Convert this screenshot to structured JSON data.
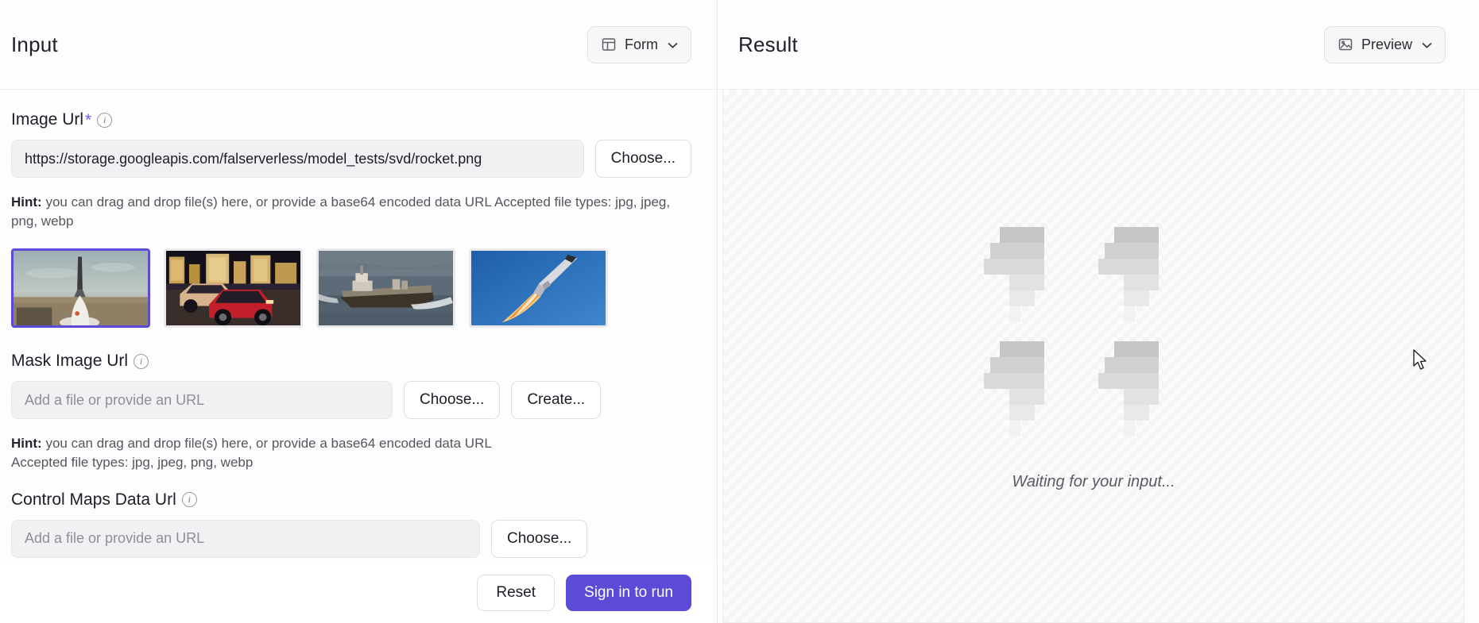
{
  "input_panel": {
    "title": "Input",
    "view_button": {
      "label": "Form",
      "icon": "layout-panel-icon",
      "chevron": "⌄"
    },
    "fields": [
      {
        "label": "Image Url",
        "required_marker": "*",
        "info_icon": "info-icon",
        "value": "https://storage.googleapis.com/falserverless/model_tests/svd/rocket.png",
        "placeholder": "Add a file or provide an URL",
        "choose_label": "Choose...",
        "hint_prefix": "Hint:",
        "hint_text": " you can drag and drop file(s) here, or provide a base64 encoded data URL Accepted file types: jpg, jpeg, png, webp"
      },
      {
        "label": "Mask Image Url",
        "required_marker": "",
        "info_icon": "info-icon",
        "value": "",
        "placeholder": "Add a file or provide an URL",
        "choose_label": "Choose...",
        "create_label": "Create...",
        "hint_prefix": "Hint:",
        "hint_text": " you can drag and drop file(s) here, or provide a base64 encoded data URL",
        "hint_line2": "Accepted file types: jpg, jpeg, png, webp"
      },
      {
        "label": "Control Maps Data Url",
        "required_marker": "",
        "info_icon": "info-icon",
        "value": "",
        "placeholder": "Add a file or provide an URL"
      }
    ],
    "thumbnails": [
      {
        "name": "rocket-launch-thumbnail",
        "selected": true
      },
      {
        "name": "red-cars-thumbnail",
        "selected": false
      },
      {
        "name": "cargo-ship-thumbnail",
        "selected": false
      },
      {
        "name": "rocket-ascending-thumbnail",
        "selected": false
      }
    ],
    "actions": {
      "reset_label": "Reset",
      "submit_label": "Sign in to run"
    }
  },
  "result_panel": {
    "title": "Result",
    "view_button": {
      "label": "Preview",
      "icon": "image-icon",
      "chevron": "⌄"
    },
    "status_text": "Waiting for your input...",
    "placeholder_icon": "image-placeholder-icon"
  },
  "colors": {
    "accent": "#5b4bd6",
    "selected_border": "#5b4bd6",
    "panel_bg": "#fdfdfd",
    "input_bg": "#f1f1f3",
    "text_primary": "#1e1e28",
    "text_muted": "#55555f"
  }
}
